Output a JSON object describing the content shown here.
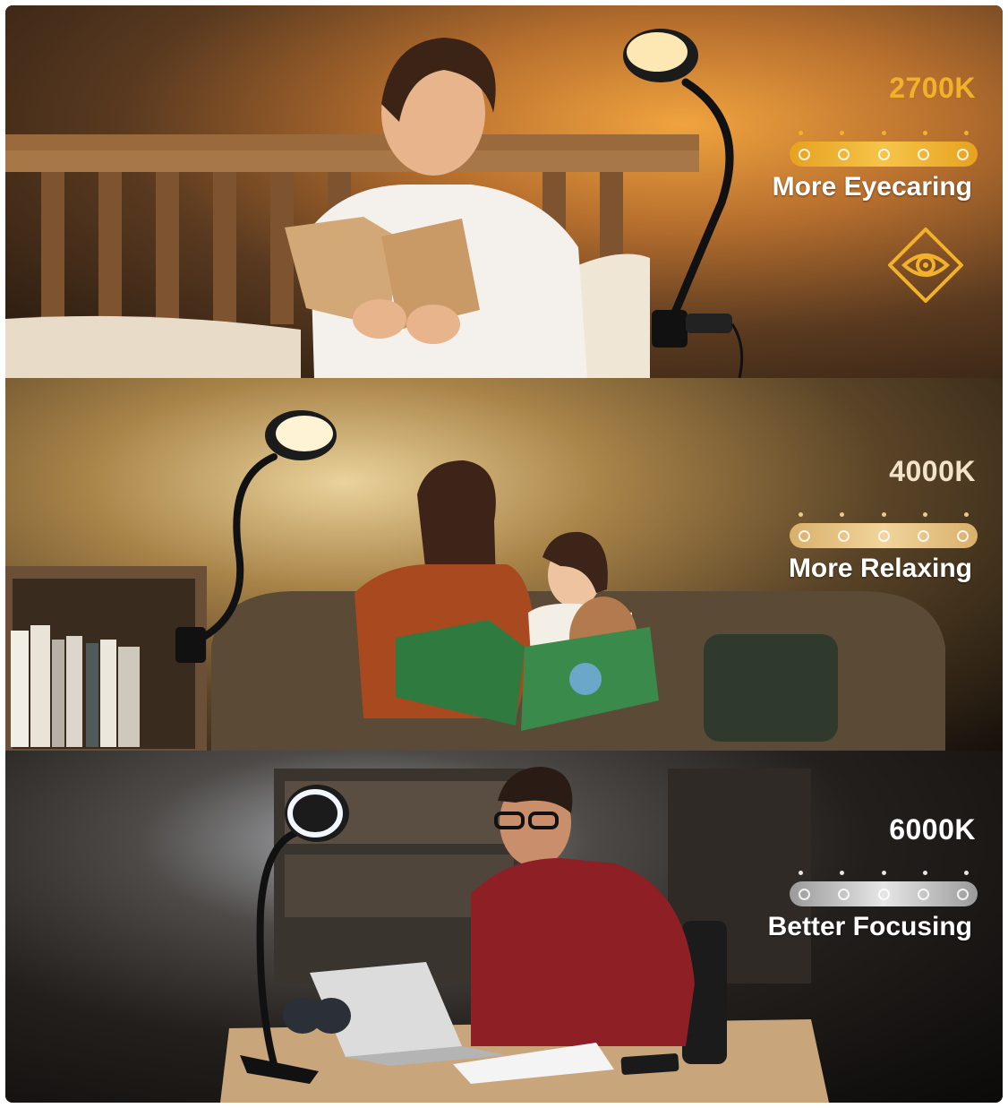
{
  "colors": {
    "warm": "#f2b12a",
    "neutral": "#e9c98a",
    "cool": "#c9c9c9"
  },
  "panels": [
    {
      "temperature": "2700K",
      "benefit": "More Eyecaring",
      "badge_icon": "eye-care-icon",
      "scene": "woman-reading-in-bed-with-clip-lamp"
    },
    {
      "temperature": "4000K",
      "benefit": "More Relaxing",
      "scene": "mother-and-daughter-reading-on-sofa"
    },
    {
      "temperature": "6000K",
      "benefit": "Better Focusing",
      "scene": "man-working-on-laptop-at-desk"
    }
  ]
}
